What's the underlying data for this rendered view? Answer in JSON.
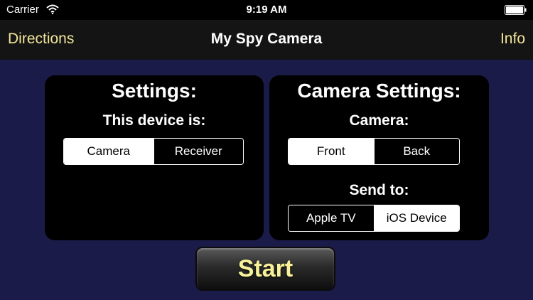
{
  "status_bar": {
    "carrier": "Carrier",
    "time": "9:19 AM",
    "wifi_icon": "wifi-icon",
    "battery_icon": "battery-icon"
  },
  "nav": {
    "left_label": "Directions",
    "title": "My Spy Camera",
    "right_label": "Info"
  },
  "settings": {
    "title": "Settings:",
    "device_label": "This device is:",
    "device_options": [
      {
        "label": "Camera",
        "selected": true
      },
      {
        "label": "Receiver",
        "selected": false
      }
    ]
  },
  "camera_settings": {
    "title": "Camera Settings:",
    "camera_label": "Camera:",
    "camera_options": [
      {
        "label": "Front",
        "selected": true
      },
      {
        "label": "Back",
        "selected": false
      }
    ],
    "send_label": "Send to:",
    "send_options": [
      {
        "label": "Apple TV",
        "selected": false
      },
      {
        "label": "iOS Device",
        "selected": true
      }
    ]
  },
  "start_button": {
    "label": "Start"
  },
  "colors": {
    "background": "#1b1b4a",
    "nav_accent": "#f2e69a",
    "start_text": "#f7f29a"
  }
}
